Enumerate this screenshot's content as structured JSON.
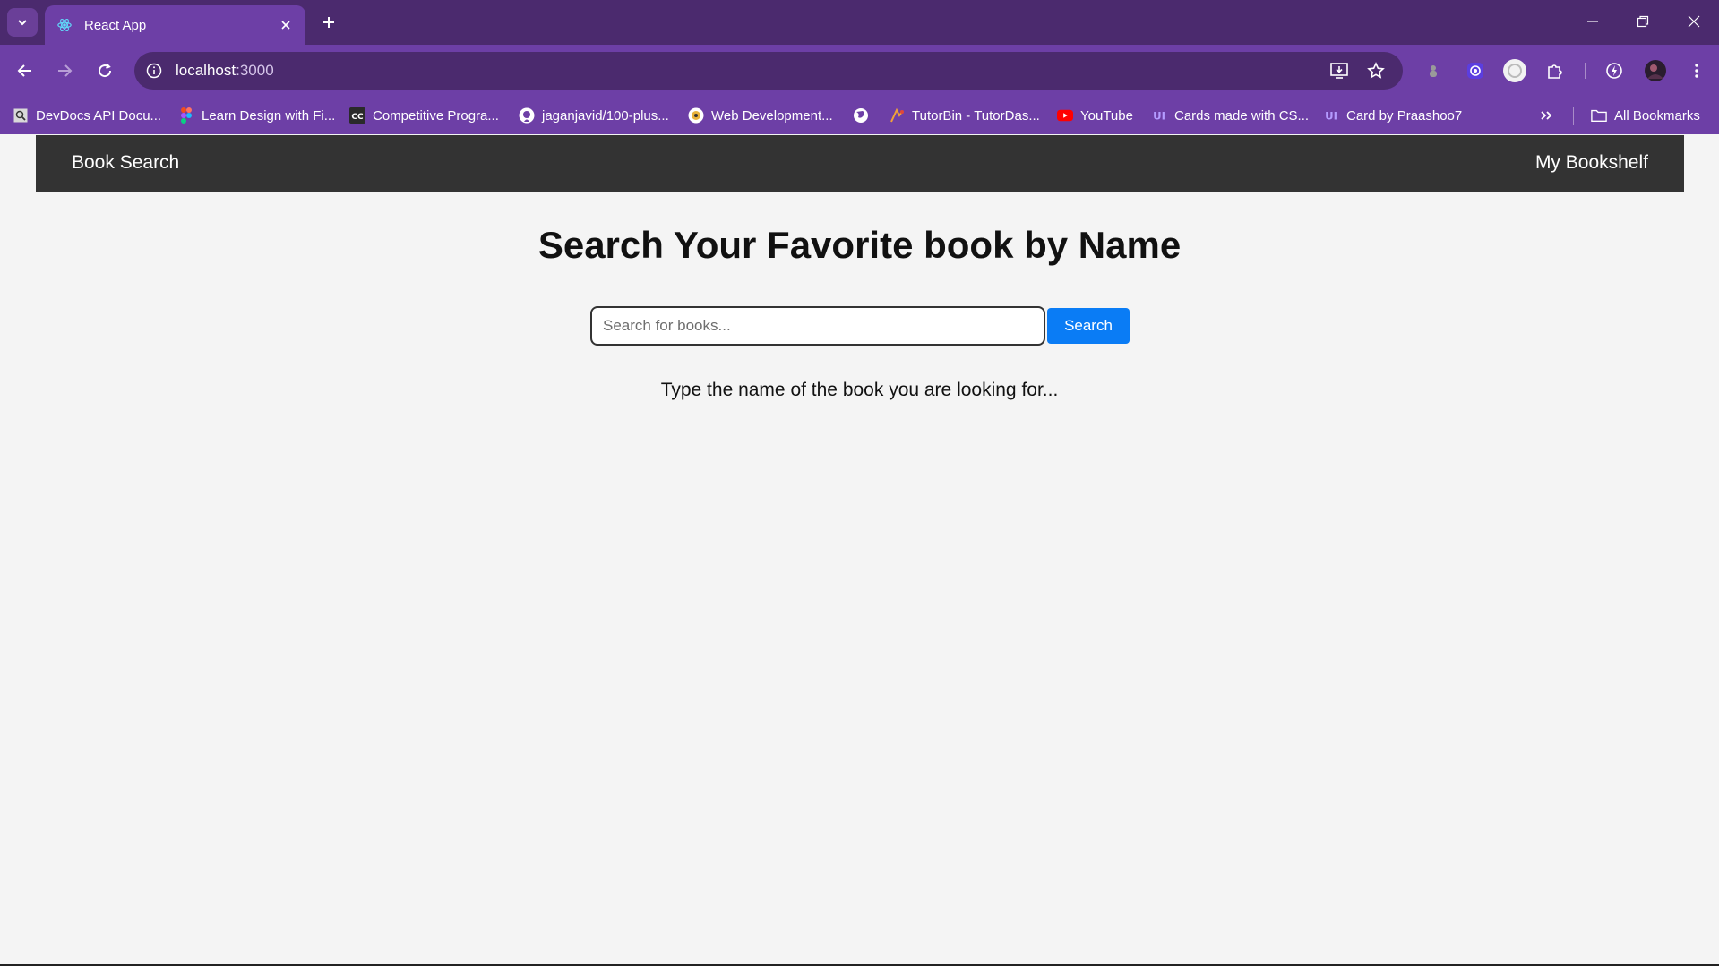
{
  "browser": {
    "tab": {
      "title": "React App"
    },
    "address": {
      "host": "localhost",
      "port": ":3000"
    },
    "bookmarks": [
      {
        "label": "DevDocs API Docu...",
        "icon": "devdocs-icon"
      },
      {
        "label": "Learn Design with Fi...",
        "icon": "figma-icon"
      },
      {
        "label": "Competitive Progra...",
        "icon": "cc-icon"
      },
      {
        "label": "jaganjavid/100-plus...",
        "icon": "github-icon"
      },
      {
        "label": "Web Development...",
        "icon": "webdev-icon"
      },
      {
        "label": "",
        "icon": "globe-icon"
      },
      {
        "label": "TutorBin - TutorDas...",
        "icon": "tutorbin-icon"
      },
      {
        "label": "YouTube",
        "icon": "youtube-icon"
      },
      {
        "label": "Cards made with CS...",
        "icon": "uiverse-icon"
      },
      {
        "label": "Card by Praashoo7",
        "icon": "uiverse-icon"
      }
    ],
    "all_bookmarks_label": "All Bookmarks",
    "colors": {
      "frame": "#4b2a6e",
      "toolbar": "#6d3fa6"
    }
  },
  "app": {
    "nav": {
      "brand": "Book Search",
      "link": "My Bookshelf"
    },
    "heading": "Search Your Favorite book by Name",
    "search": {
      "placeholder": "Search for books...",
      "value": "",
      "button": "Search"
    },
    "hint": "Type the name of the book you are looking for...",
    "colors": {
      "navbar": "#333333",
      "button": "#0a7cf5",
      "background": "#f4f4f4"
    }
  }
}
